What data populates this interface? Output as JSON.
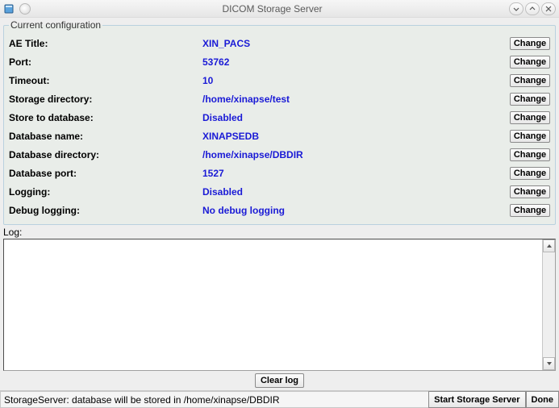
{
  "window": {
    "title": "DICOM Storage Server"
  },
  "config": {
    "legend": "Current configuration",
    "change_label": "Change",
    "rows": [
      {
        "label": "AE Title:",
        "value": "XIN_PACS"
      },
      {
        "label": "Port:",
        "value": "53762"
      },
      {
        "label": "Timeout:",
        "value": "10"
      },
      {
        "label": "Storage directory:",
        "value": "/home/xinapse/test"
      },
      {
        "label": "Store to database:",
        "value": "Disabled"
      },
      {
        "label": "Database name:",
        "value": "XINAPSEDB"
      },
      {
        "label": "Database directory:",
        "value": "/home/xinapse/DBDIR"
      },
      {
        "label": "Database port:",
        "value": "1527"
      },
      {
        "label": "Logging:",
        "value": "Disabled"
      },
      {
        "label": "Debug logging:",
        "value": "No debug logging"
      }
    ]
  },
  "log": {
    "label": "Log:",
    "clear_label": "Clear log",
    "content": ""
  },
  "status": {
    "message": "StorageServer: database will be stored in /home/xinapse/DBDIR",
    "start_label": "Start Storage Server",
    "done_label": "Done"
  }
}
